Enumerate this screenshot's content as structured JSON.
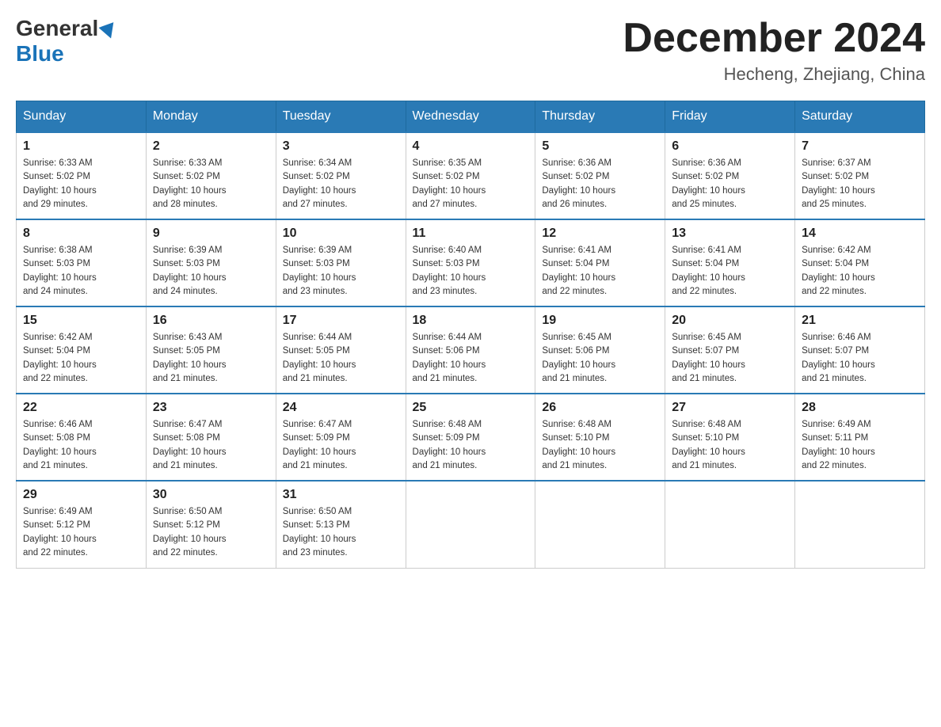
{
  "logo": {
    "general": "General",
    "blue": "Blue"
  },
  "title": {
    "month_year": "December 2024",
    "location": "Hecheng, Zhejiang, China"
  },
  "headers": [
    "Sunday",
    "Monday",
    "Tuesday",
    "Wednesday",
    "Thursday",
    "Friday",
    "Saturday"
  ],
  "weeks": [
    [
      {
        "day": "1",
        "sunrise": "6:33 AM",
        "sunset": "5:02 PM",
        "daylight": "10 hours and 29 minutes."
      },
      {
        "day": "2",
        "sunrise": "6:33 AM",
        "sunset": "5:02 PM",
        "daylight": "10 hours and 28 minutes."
      },
      {
        "day": "3",
        "sunrise": "6:34 AM",
        "sunset": "5:02 PM",
        "daylight": "10 hours and 27 minutes."
      },
      {
        "day": "4",
        "sunrise": "6:35 AM",
        "sunset": "5:02 PM",
        "daylight": "10 hours and 27 minutes."
      },
      {
        "day": "5",
        "sunrise": "6:36 AM",
        "sunset": "5:02 PM",
        "daylight": "10 hours and 26 minutes."
      },
      {
        "day": "6",
        "sunrise": "6:36 AM",
        "sunset": "5:02 PM",
        "daylight": "10 hours and 25 minutes."
      },
      {
        "day": "7",
        "sunrise": "6:37 AM",
        "sunset": "5:02 PM",
        "daylight": "10 hours and 25 minutes."
      }
    ],
    [
      {
        "day": "8",
        "sunrise": "6:38 AM",
        "sunset": "5:03 PM",
        "daylight": "10 hours and 24 minutes."
      },
      {
        "day": "9",
        "sunrise": "6:39 AM",
        "sunset": "5:03 PM",
        "daylight": "10 hours and 24 minutes."
      },
      {
        "day": "10",
        "sunrise": "6:39 AM",
        "sunset": "5:03 PM",
        "daylight": "10 hours and 23 minutes."
      },
      {
        "day": "11",
        "sunrise": "6:40 AM",
        "sunset": "5:03 PM",
        "daylight": "10 hours and 23 minutes."
      },
      {
        "day": "12",
        "sunrise": "6:41 AM",
        "sunset": "5:04 PM",
        "daylight": "10 hours and 22 minutes."
      },
      {
        "day": "13",
        "sunrise": "6:41 AM",
        "sunset": "5:04 PM",
        "daylight": "10 hours and 22 minutes."
      },
      {
        "day": "14",
        "sunrise": "6:42 AM",
        "sunset": "5:04 PM",
        "daylight": "10 hours and 22 minutes."
      }
    ],
    [
      {
        "day": "15",
        "sunrise": "6:42 AM",
        "sunset": "5:04 PM",
        "daylight": "10 hours and 22 minutes."
      },
      {
        "day": "16",
        "sunrise": "6:43 AM",
        "sunset": "5:05 PM",
        "daylight": "10 hours and 21 minutes."
      },
      {
        "day": "17",
        "sunrise": "6:44 AM",
        "sunset": "5:05 PM",
        "daylight": "10 hours and 21 minutes."
      },
      {
        "day": "18",
        "sunrise": "6:44 AM",
        "sunset": "5:06 PM",
        "daylight": "10 hours and 21 minutes."
      },
      {
        "day": "19",
        "sunrise": "6:45 AM",
        "sunset": "5:06 PM",
        "daylight": "10 hours and 21 minutes."
      },
      {
        "day": "20",
        "sunrise": "6:45 AM",
        "sunset": "5:07 PM",
        "daylight": "10 hours and 21 minutes."
      },
      {
        "day": "21",
        "sunrise": "6:46 AM",
        "sunset": "5:07 PM",
        "daylight": "10 hours and 21 minutes."
      }
    ],
    [
      {
        "day": "22",
        "sunrise": "6:46 AM",
        "sunset": "5:08 PM",
        "daylight": "10 hours and 21 minutes."
      },
      {
        "day": "23",
        "sunrise": "6:47 AM",
        "sunset": "5:08 PM",
        "daylight": "10 hours and 21 minutes."
      },
      {
        "day": "24",
        "sunrise": "6:47 AM",
        "sunset": "5:09 PM",
        "daylight": "10 hours and 21 minutes."
      },
      {
        "day": "25",
        "sunrise": "6:48 AM",
        "sunset": "5:09 PM",
        "daylight": "10 hours and 21 minutes."
      },
      {
        "day": "26",
        "sunrise": "6:48 AM",
        "sunset": "5:10 PM",
        "daylight": "10 hours and 21 minutes."
      },
      {
        "day": "27",
        "sunrise": "6:48 AM",
        "sunset": "5:10 PM",
        "daylight": "10 hours and 21 minutes."
      },
      {
        "day": "28",
        "sunrise": "6:49 AM",
        "sunset": "5:11 PM",
        "daylight": "10 hours and 22 minutes."
      }
    ],
    [
      {
        "day": "29",
        "sunrise": "6:49 AM",
        "sunset": "5:12 PM",
        "daylight": "10 hours and 22 minutes."
      },
      {
        "day": "30",
        "sunrise": "6:50 AM",
        "sunset": "5:12 PM",
        "daylight": "10 hours and 22 minutes."
      },
      {
        "day": "31",
        "sunrise": "6:50 AM",
        "sunset": "5:13 PM",
        "daylight": "10 hours and 23 minutes."
      },
      null,
      null,
      null,
      null
    ]
  ],
  "labels": {
    "sunrise": "Sunrise:",
    "sunset": "Sunset:",
    "daylight": "Daylight:"
  }
}
